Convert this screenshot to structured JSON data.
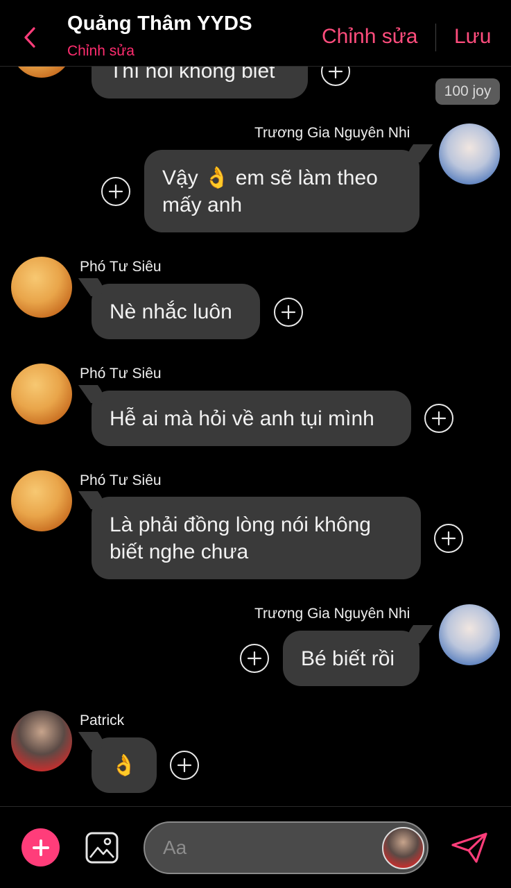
{
  "header": {
    "title": "Quảng Thâm YYDS",
    "subtitle": "Chỉnh sửa",
    "edit_label": "Chỉnh sửa",
    "save_label": "Lưu"
  },
  "colors": {
    "accent": "#ff4d7d",
    "bubble": "#3a3a3a",
    "background": "#000000"
  },
  "icons": {
    "back": "chevron-left-icon",
    "plus": "plus-circle-icon",
    "add": "plus-icon",
    "image": "image-icon",
    "send": "send-icon"
  },
  "messages": [
    {
      "sender": "",
      "text": "Thì nói không biết",
      "side": "left",
      "reaction_badge": "100 joy"
    },
    {
      "sender": "Trương Gia Nguyên Nhi",
      "text": "Vậy 👌 em sẽ làm theo mấy anh",
      "side": "right"
    },
    {
      "sender": "Phó Tư Siêu",
      "text": "Nè nhắc luôn",
      "side": "left"
    },
    {
      "sender": "Phó Tư Siêu",
      "text": "Hễ ai mà hỏi về anh tụi mình",
      "side": "left"
    },
    {
      "sender": "Phó Tư Siêu",
      "text": "Là phải đồng lòng nói không biết nghe chưa",
      "side": "left"
    },
    {
      "sender": "Trương Gia Nguyên Nhi",
      "text": "Bé biết rồi",
      "side": "right"
    },
    {
      "sender": "Patrick",
      "text": "👌",
      "side": "left"
    }
  ],
  "composer": {
    "placeholder": "Aa"
  }
}
